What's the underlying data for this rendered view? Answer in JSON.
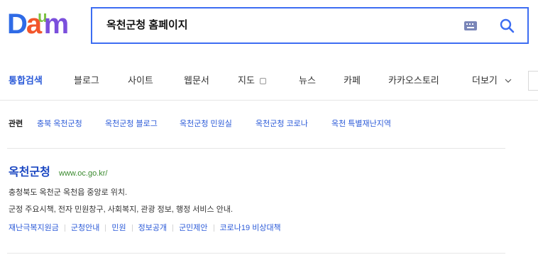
{
  "logo": {
    "letters": [
      "D",
      "a",
      "u",
      "m"
    ]
  },
  "search": {
    "query": "옥천군청 홈페이지",
    "keyboard_icon": "keyboard-icon",
    "search_icon": "search-icon"
  },
  "tabs": [
    {
      "label": "통합검색",
      "active": true
    },
    {
      "label": "블로그",
      "active": false
    },
    {
      "label": "사이트",
      "active": false
    },
    {
      "label": "웹문서",
      "active": false
    },
    {
      "label": "지도",
      "active": false,
      "icon": "map-icon"
    },
    {
      "label": "뉴스",
      "active": false
    },
    {
      "label": "카페",
      "active": false
    },
    {
      "label": "카카오스토리",
      "active": false
    },
    {
      "label": "더보기",
      "active": false,
      "icon": "chevron-down-icon"
    }
  ],
  "related": {
    "label": "관련",
    "links": [
      "충북 옥천군청",
      "옥천군청 블로그",
      "옥천군청 민원실",
      "옥천군청 코로나",
      "옥천 특별재난지역"
    ]
  },
  "result": {
    "title": "옥천군청",
    "url": "www.oc.go.kr/",
    "description": [
      "충청북도 옥천군 옥천읍 중앙로 위치.",
      "군정 주요시책, 전자 민원창구, 사회복지, 관광 정보, 행정 서비스 안내."
    ],
    "sitelinks": [
      "재난극복지원금",
      "군청안내",
      "민원",
      "정보공개",
      "군민제안",
      "코로나19 비상대책"
    ]
  },
  "colors": {
    "brand_blue": "#3d6df2",
    "link_blue": "#2c5bd8",
    "title_blue": "#1b47c2",
    "url_green": "#3a8a2e",
    "text": "#333333",
    "divider": "#e5e5e5"
  }
}
